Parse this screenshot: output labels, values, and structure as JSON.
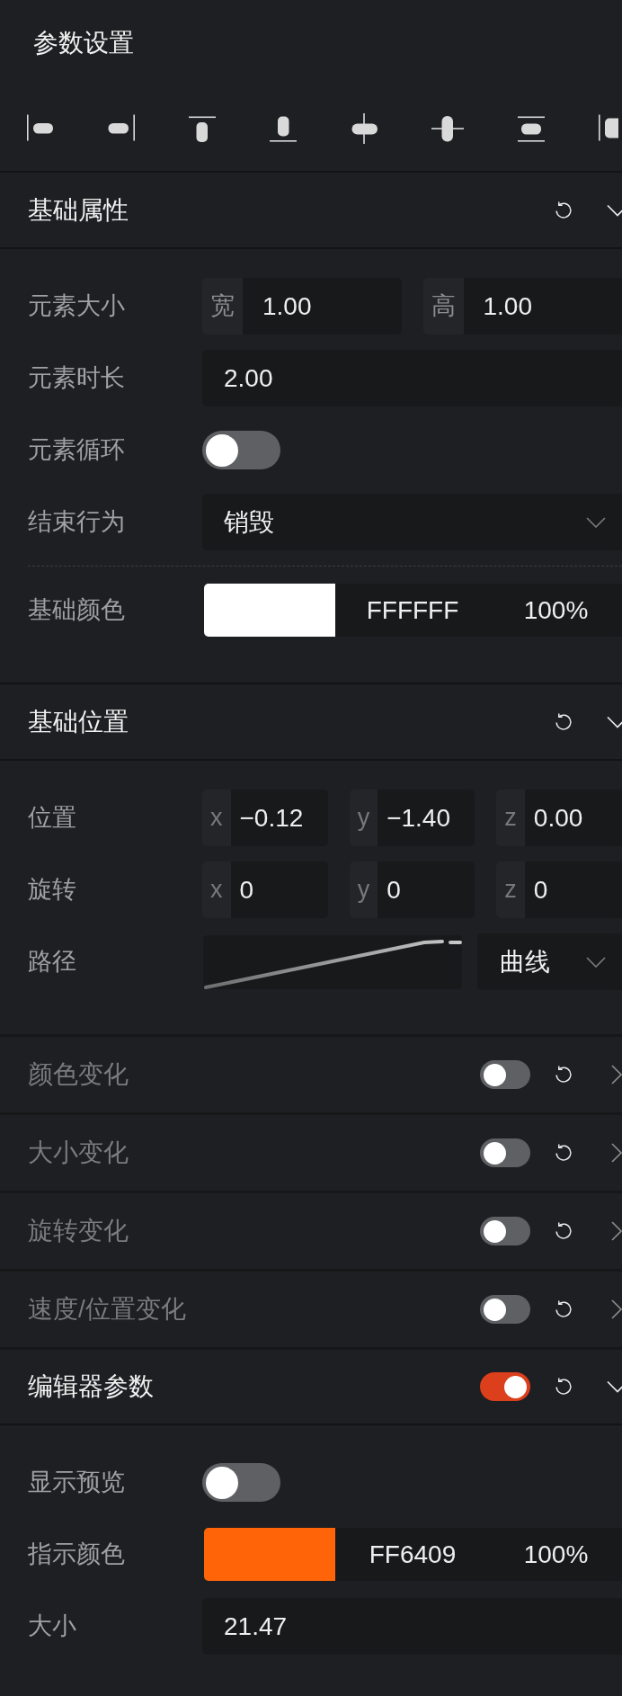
{
  "panel": {
    "title": "参数设置"
  },
  "sections": [
    {
      "kind": "basic",
      "title": "基础属性",
      "expanded": true,
      "rows": [
        {
          "kind": "pair",
          "label": "元素大小",
          "fields": [
            {
              "prefix": "宽",
              "value": "1.00"
            },
            {
              "prefix": "高",
              "value": "1.00"
            }
          ]
        },
        {
          "kind": "number",
          "label": "元素时长",
          "value": "2.00"
        },
        {
          "kind": "toggle",
          "label": "元素循环",
          "on": false
        },
        {
          "kind": "select",
          "label": "结束行为",
          "value": "销毁"
        },
        {
          "kind": "divider"
        },
        {
          "kind": "color",
          "label": "基础颜色",
          "color": "#ffffff",
          "hex": "FFFFFF",
          "opacity": "100%"
        }
      ]
    },
    {
      "kind": "basic",
      "title": "基础位置",
      "expanded": true,
      "rows": [
        {
          "kind": "vector",
          "label": "位置",
          "fields": [
            {
              "prefix": "x",
              "value": "−0.12"
            },
            {
              "prefix": "y",
              "value": "−1.40"
            },
            {
              "prefix": "z",
              "value": "0.00"
            }
          ]
        },
        {
          "kind": "vector",
          "label": "旋转",
          "fields": [
            {
              "prefix": "x",
              "value": "0"
            },
            {
              "prefix": "y",
              "value": "0"
            },
            {
              "prefix": "z",
              "value": "0"
            }
          ]
        },
        {
          "kind": "curve",
          "label": "路径",
          "value": "曲线"
        }
      ]
    },
    {
      "kind": "switchable",
      "title": "颜色变化",
      "on": false,
      "expanded": false
    },
    {
      "kind": "switchable",
      "title": "大小变化",
      "on": false,
      "expanded": false
    },
    {
      "kind": "switchable",
      "title": "旋转变化",
      "on": false,
      "expanded": false
    },
    {
      "kind": "switchable",
      "title": "速度/位置变化",
      "on": false,
      "expanded": false
    },
    {
      "kind": "switchable",
      "title": "编辑器参数",
      "on": true,
      "expanded": true,
      "rows": [
        {
          "kind": "toggle",
          "label": "显示预览",
          "on": false
        },
        {
          "kind": "color",
          "label": "指示颜色",
          "color": "#ff6409",
          "hex": "FF6409",
          "opacity": "100%"
        },
        {
          "kind": "number",
          "label": "大小",
          "value": "21.47"
        }
      ]
    }
  ]
}
